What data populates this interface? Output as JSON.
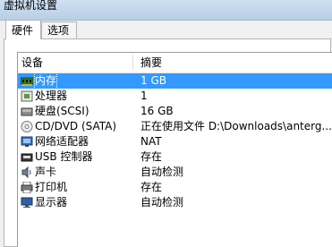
{
  "window": {
    "title": "虚拟机设置"
  },
  "tabs": [
    {
      "label": "硬件",
      "active": true
    },
    {
      "label": "选项",
      "active": false
    }
  ],
  "table": {
    "columns": [
      "设备",
      "摘要"
    ],
    "rows": [
      {
        "icon": "memory-icon",
        "device": "内存",
        "summary": "1 GB",
        "selected": true
      },
      {
        "icon": "processor-icon",
        "device": "处理器",
        "summary": "1",
        "selected": false
      },
      {
        "icon": "hard-disk-icon",
        "device": "硬盘(SCSI)",
        "summary": "16 GB",
        "selected": false
      },
      {
        "icon": "cd-dvd-icon",
        "device": "CD/DVD (SATA)",
        "summary": "正在使用文件 D:\\Downloads\\anterg...",
        "selected": false
      },
      {
        "icon": "network-adapter-icon",
        "device": "网络适配器",
        "summary": "NAT",
        "selected": false
      },
      {
        "icon": "usb-controller-icon",
        "device": "USB 控制器",
        "summary": "存在",
        "selected": false
      },
      {
        "icon": "sound-card-icon",
        "device": "声卡",
        "summary": "自动检测",
        "selected": false
      },
      {
        "icon": "printer-icon",
        "device": "打印机",
        "summary": "存在",
        "selected": false
      },
      {
        "icon": "display-icon",
        "device": "显示器",
        "summary": "自动检测",
        "selected": false
      }
    ]
  },
  "colors": {
    "selection": "#3399ff",
    "titlebar": "#cfe0f1"
  }
}
